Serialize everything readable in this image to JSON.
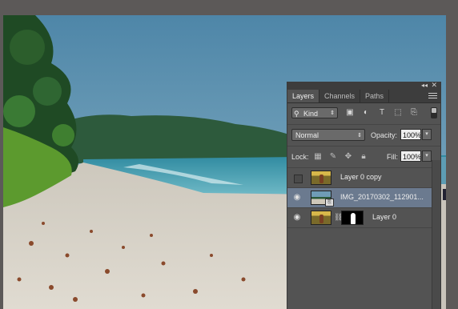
{
  "panel": {
    "tabs": [
      {
        "label": "Layers",
        "active": true
      },
      {
        "label": "Channels",
        "active": false
      },
      {
        "label": "Paths",
        "active": false
      }
    ],
    "filter": {
      "kind_label": "Kind"
    },
    "blend_mode": "Normal",
    "opacity": {
      "label": "Opacity:",
      "value": "100%"
    },
    "lock": {
      "label": "Lock:"
    },
    "fill": {
      "label": "Fill:",
      "value": "100%"
    },
    "layers": [
      {
        "name": "Layer 0 copy",
        "visible": false,
        "selected": false
      },
      {
        "name": "IMG_20170302_112901...",
        "visible": true,
        "selected": true
      },
      {
        "name": "Layer 0",
        "visible": true,
        "selected": false
      }
    ]
  },
  "colors": {
    "panel_bg": "#535353",
    "selected_row": "#6b7a8f",
    "sky": "#6f9cb6",
    "sea": "#3b94a6",
    "sand": "#d3cdc1"
  }
}
